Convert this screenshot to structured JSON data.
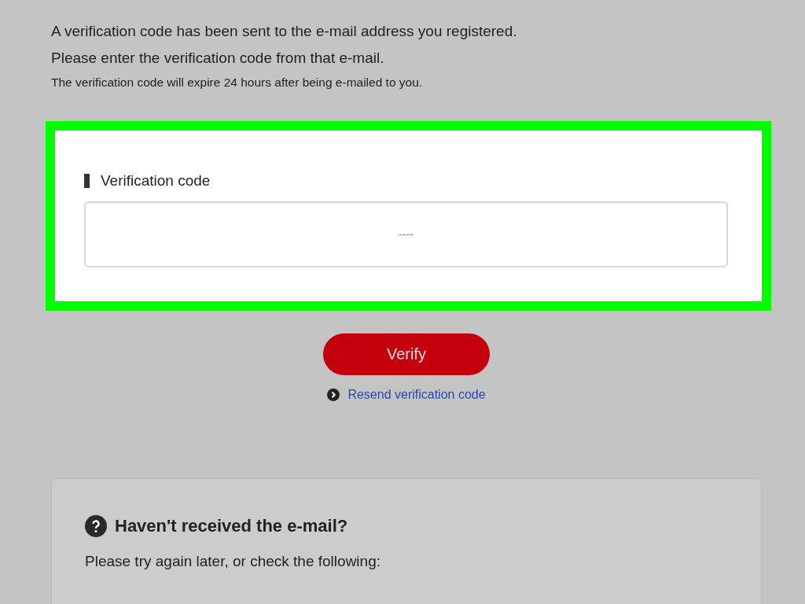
{
  "intro": {
    "lines": [
      "A verification code has been sent to the e-mail address you registered.",
      "Please enter the verification code from that e-mail."
    ],
    "note": "The verification code will expire 24 hours after being e-mailed to you."
  },
  "form": {
    "label": "Verification code",
    "placeholder": "----"
  },
  "verify_button": "Verify",
  "resend_link": "Resend verification code",
  "help": {
    "title": "Haven't received the e-mail?",
    "text": "Please try again later, or check the following:"
  }
}
